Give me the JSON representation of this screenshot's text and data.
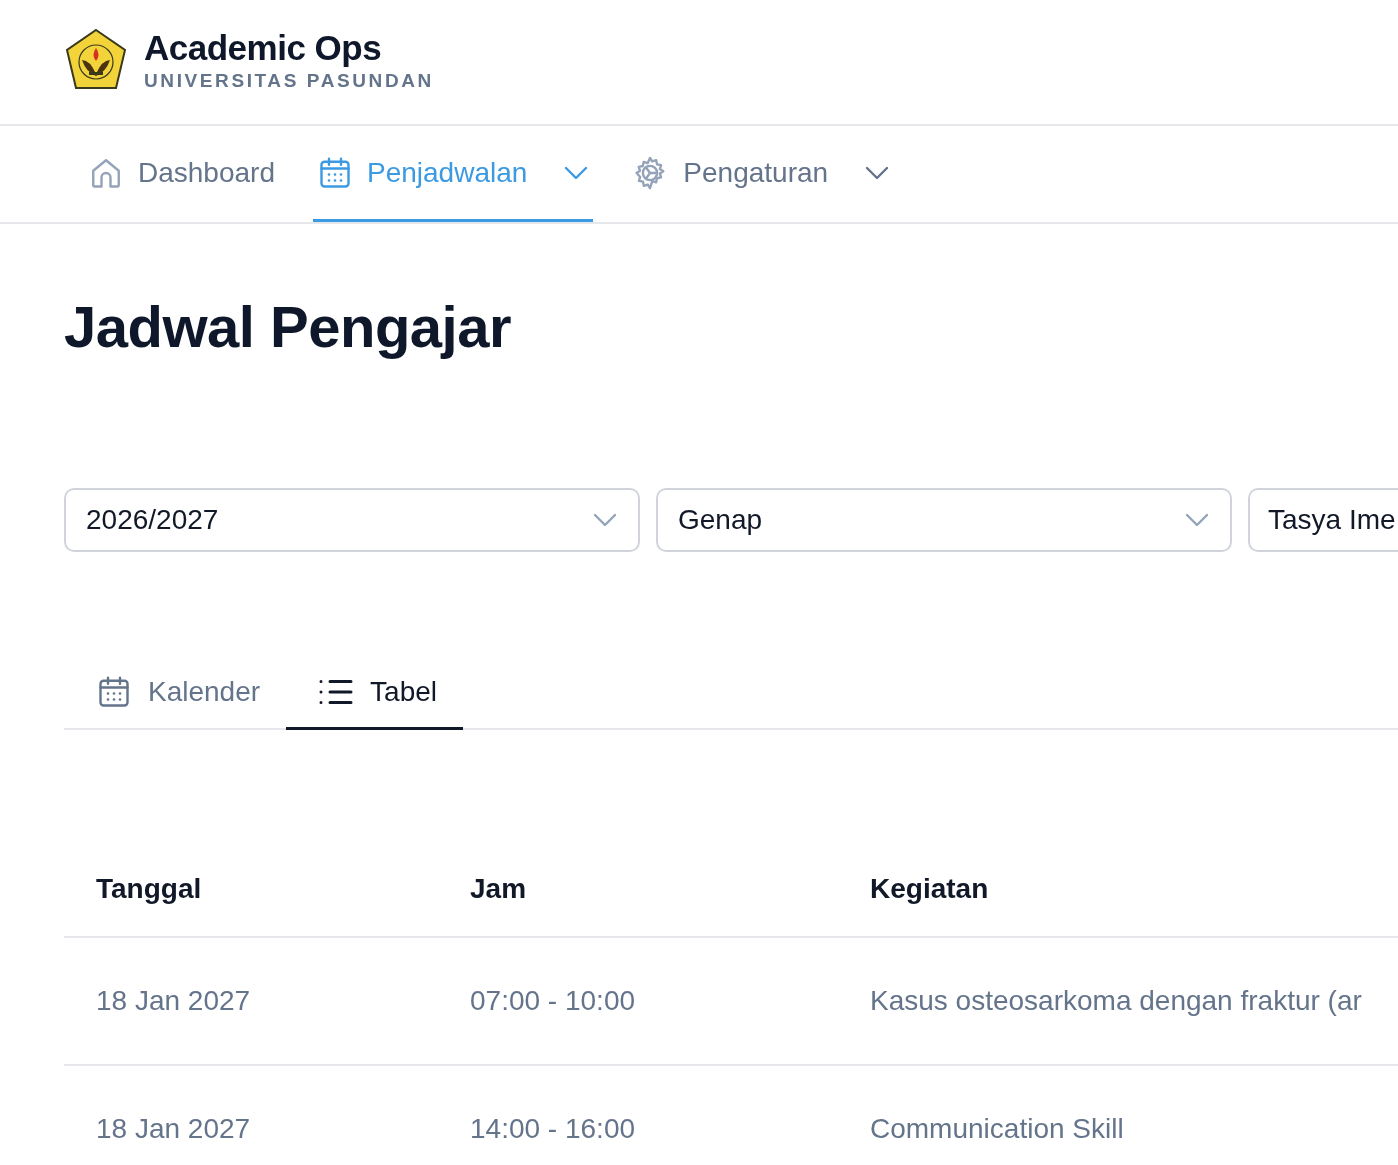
{
  "brand": {
    "title": "Academic Ops",
    "subtitle": "UNIVERSITAS PASUNDAN"
  },
  "nav": [
    {
      "label": "Dashboard",
      "kind": "link",
      "selected": false
    },
    {
      "label": "Penjadwalan",
      "kind": "menu",
      "selected": true
    },
    {
      "label": "Pengaturan",
      "kind": "menu",
      "selected": false
    }
  ],
  "page_title": "Jadwal Pengajar",
  "filters": [
    {
      "value": "2026/2027",
      "kind": "select"
    },
    {
      "value": "Genap",
      "kind": "select"
    },
    {
      "value": "Tasya Ime",
      "kind": "partial"
    }
  ],
  "view_tabs": [
    {
      "label": "Kalender",
      "selected": false
    },
    {
      "label": "Tabel",
      "selected": true
    }
  ],
  "table": {
    "columns": [
      "Tanggal",
      "Jam",
      "Kegiatan"
    ],
    "rows": [
      [
        "18 Jan 2027",
        "07:00 - 10:00",
        "Kasus osteosarkoma dengan fraktur (ar"
      ],
      [
        "18 Jan 2027",
        "14:00 - 16:00",
        "Communication Skill"
      ]
    ]
  }
}
